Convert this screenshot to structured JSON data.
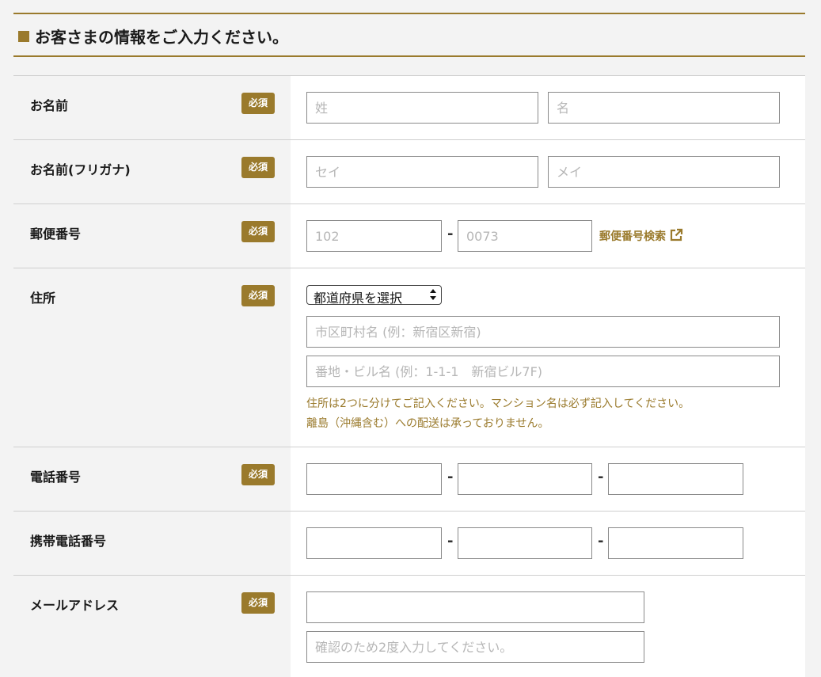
{
  "section": {
    "title": "お客さまの情報をご入力ください。"
  },
  "required_label": "必須",
  "rows": {
    "name": {
      "label": "お名前",
      "last_placeholder": "姓",
      "first_placeholder": "名"
    },
    "kana": {
      "label": "お名前(フリガナ)",
      "last_placeholder": "セイ",
      "first_placeholder": "メイ"
    },
    "zip": {
      "label": "郵便番号",
      "part1_placeholder": "102",
      "part2_placeholder": "0073",
      "dash": "-",
      "search_link": "郵便番号検索"
    },
    "address": {
      "label": "住所",
      "prefecture_selected": "都道府県を選択",
      "city_placeholder": "市区町村名 (例：新宿区新宿)",
      "street_placeholder": "番地・ビル名 (例：1-1-1　新宿ビル7F)",
      "note1": "住所は2つに分けてご記入ください。マンション名は必ず記入してください。",
      "note2": "離島（沖縄含む）への配送は承っておりません。"
    },
    "phone": {
      "label": "電話番号",
      "dash": "-"
    },
    "mobile": {
      "label": "携帯電話番号",
      "dash": "-"
    },
    "email": {
      "label": "メールアドレス",
      "confirm_placeholder": "確認のため2度入力してください。"
    }
  },
  "colors": {
    "accent": "#9a7a2c",
    "label_bg": "#f3f3f3",
    "value_bg": "#ffffff",
    "border": "#cfcfcf"
  },
  "icons": {
    "zip_link": "external-link-icon",
    "select": "select-arrows-icon",
    "section_marker": "square-marker-icon"
  }
}
